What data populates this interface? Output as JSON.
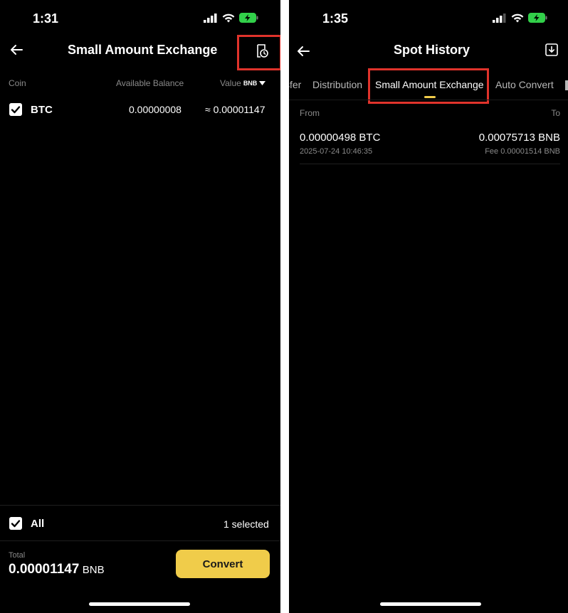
{
  "left": {
    "status_time": "1:31",
    "title": "Small Amount Exchange",
    "columns": {
      "coin": "Coin",
      "available_balance": "Available Balance",
      "value": "Value",
      "value_unit": "BNB"
    },
    "rows": [
      {
        "coin": "BTC",
        "balance": "0.00000008",
        "value": "≈ 0.00001147",
        "checked": true
      }
    ],
    "footer": {
      "all_label": "All",
      "selected_text": "1 selected",
      "total_label": "Total",
      "total_value": "0.00001147",
      "total_unit": "BNB",
      "convert_label": "Convert"
    }
  },
  "right": {
    "status_time": "1:35",
    "title": "Spot History",
    "tabs": [
      {
        "label": "sfer",
        "active": false
      },
      {
        "label": "Distribution",
        "active": false
      },
      {
        "label": "Small Amount Exchange",
        "active": true
      },
      {
        "label": "Auto Convert",
        "active": false
      }
    ],
    "columns": {
      "from": "From",
      "to": "To"
    },
    "records": [
      {
        "from_amount": "0.00000498 BTC",
        "datetime": "2025-07-24 10:46:35",
        "to_amount": "0.00075713 BNB",
        "fee": "Fee 0.00001514 BNB"
      }
    ]
  },
  "colors": {
    "background": "#000000",
    "accent_yellow": "#f0cc4a",
    "highlight_red": "#e0332b",
    "muted_text": "#8a8a8a"
  },
  "icons": [
    "back-arrow-icon",
    "history-icon",
    "download-icon",
    "checkbox-checked-icon",
    "caret-down-icon",
    "signal-icon",
    "wifi-icon",
    "battery-charging-icon"
  ]
}
